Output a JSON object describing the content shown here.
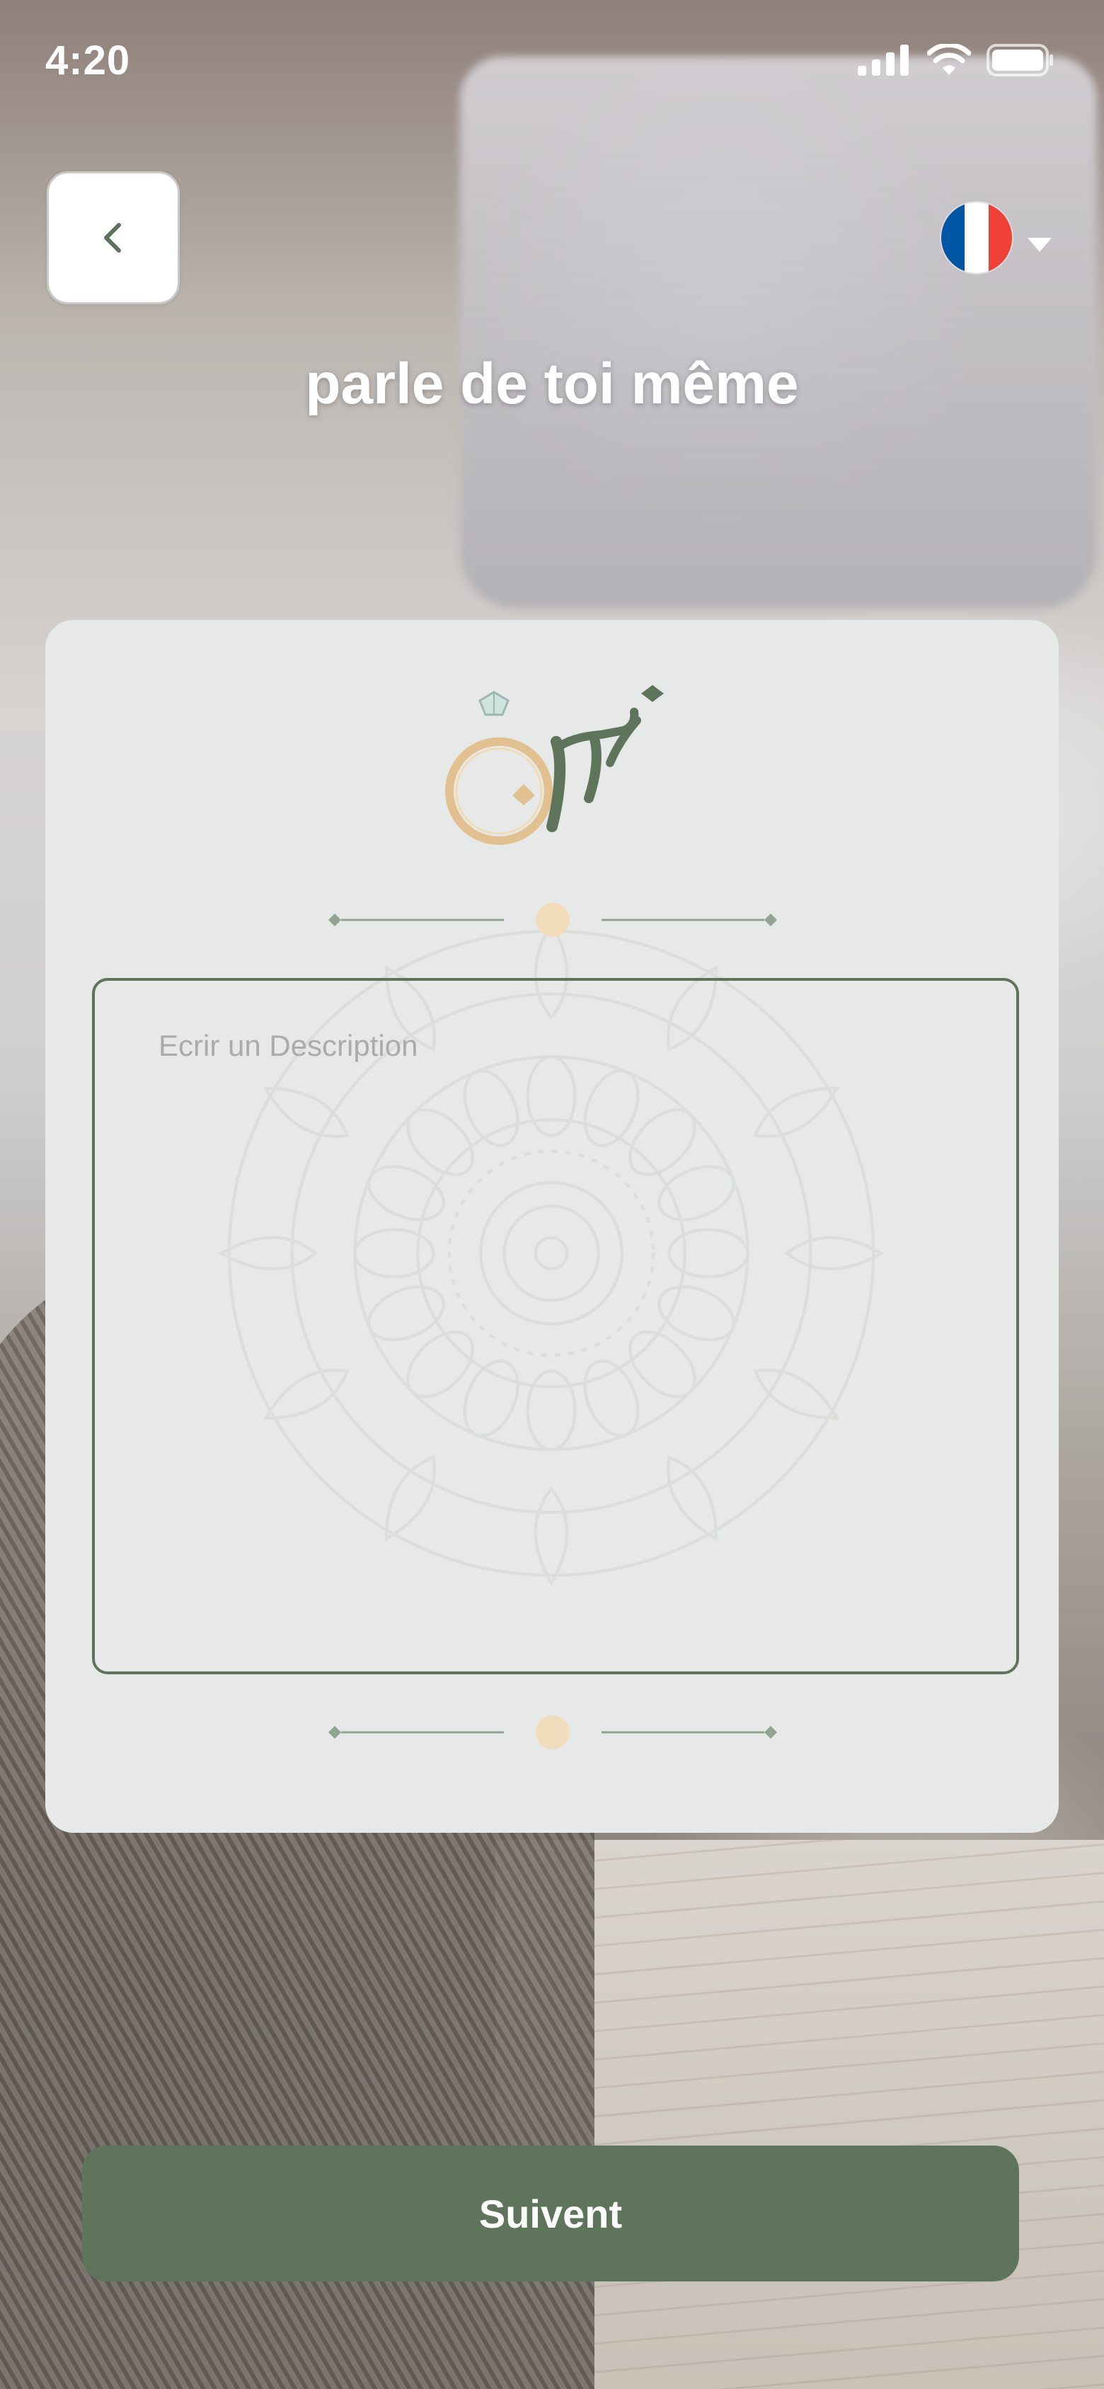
{
  "status_bar": {
    "time": "4:20",
    "icons": [
      "cellular-signal-icon",
      "wifi-icon",
      "battery-icon"
    ]
  },
  "header": {
    "back_icon": "chevron-left-icon",
    "language": {
      "flag": "france-flag-icon",
      "flag_colors": [
        "#0055A4",
        "#FFFFFF",
        "#EF4135"
      ],
      "dropdown_icon": "caret-down-icon"
    },
    "title": "parle de toi même"
  },
  "card": {
    "logo_icon": "ring-logo-icon",
    "description_input": {
      "placeholder": "Ecrir un Description",
      "value": ""
    }
  },
  "footer": {
    "submit_label": "Suivent"
  },
  "colors": {
    "accent": "#5F755B",
    "card_background": "#E6E9E7",
    "gold": "#E2C08F",
    "placeholder": "#A9ACAA"
  }
}
